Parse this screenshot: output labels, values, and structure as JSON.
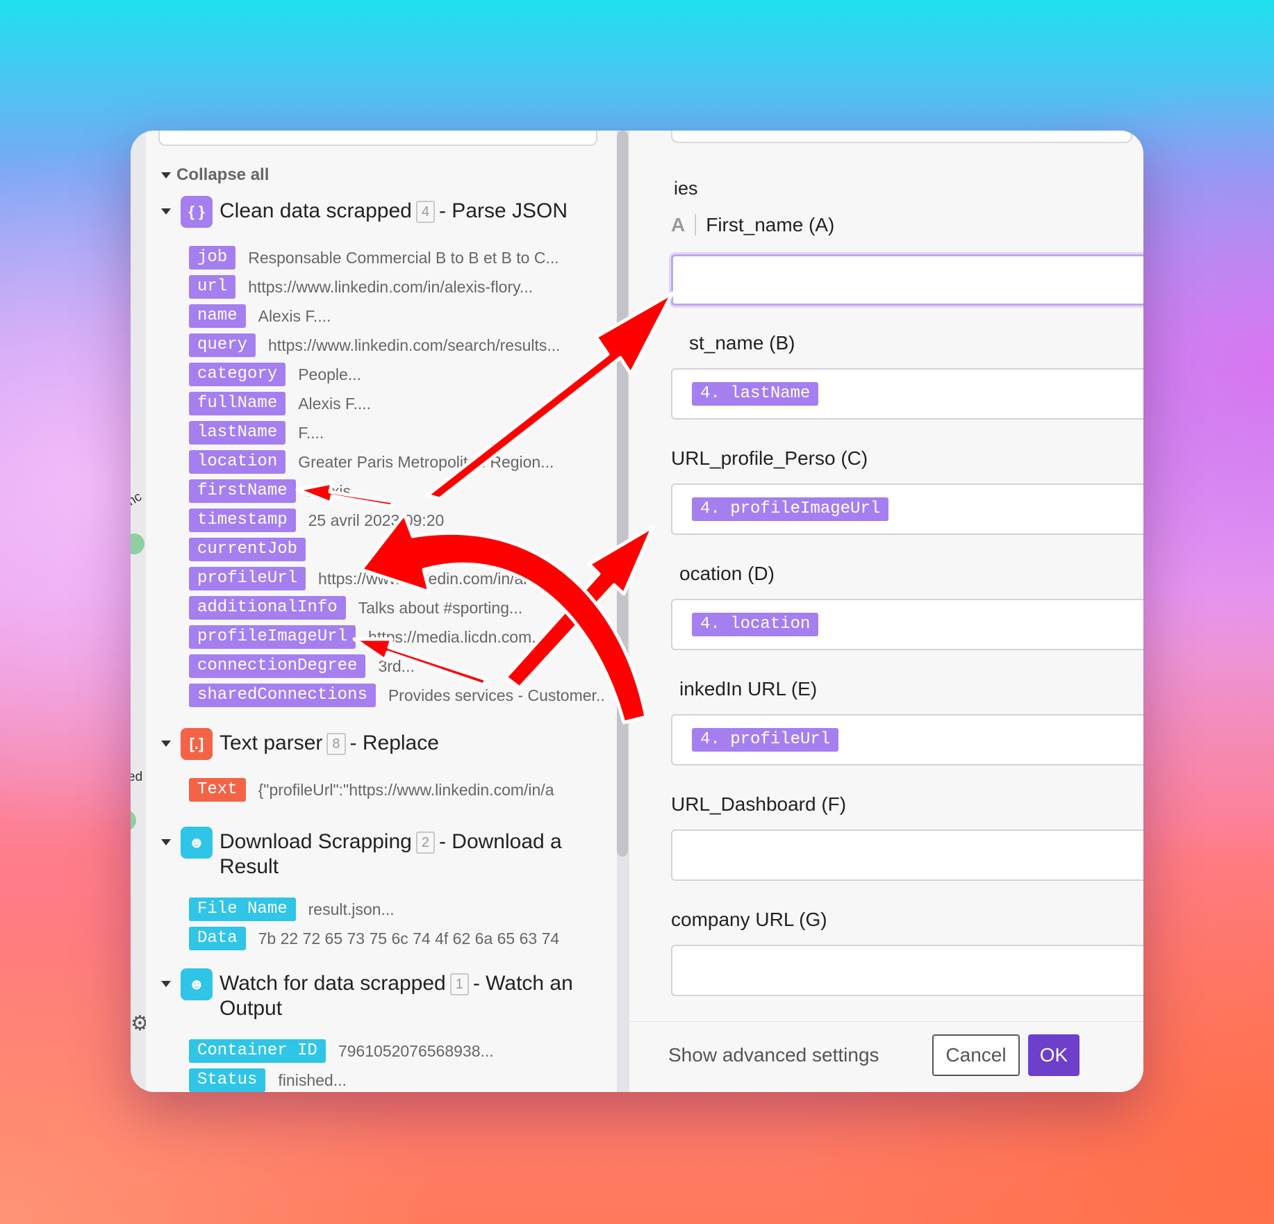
{
  "colors": {
    "purple": "#a57ff0",
    "orange": "#f46346",
    "teal": "#2fc5e6",
    "ok": "#6d3fcb",
    "arrow": "#ff0000"
  },
  "left": {
    "collapse_all": "Collapse all",
    "modules": [
      {
        "icon": "braces-icon",
        "icon_glyph": "{ }",
        "name": "Clean data scrapped",
        "num": "4",
        "action": "- Parse JSON",
        "rows": [
          {
            "key": "job",
            "value": "Responsable Commercial B to B et B to C..."
          },
          {
            "key": "url",
            "value": "https://www.linkedin.com/in/alexis-flory..."
          },
          {
            "key": "name",
            "value": "Alexis F...."
          },
          {
            "key": "query",
            "value": "https://www.linkedin.com/search/results..."
          },
          {
            "key": "category",
            "value": "People..."
          },
          {
            "key": "fullName",
            "value": "Alexis F...."
          },
          {
            "key": "lastName",
            "value": "F...."
          },
          {
            "key": "location",
            "value": "Greater Paris Metropolitan Region..."
          },
          {
            "key": "firstName",
            "value": "Alexis..."
          },
          {
            "key": "timestamp",
            "value": "25 avril 2023 09:20"
          },
          {
            "key": "currentJob",
            "value": ""
          },
          {
            "key": "profileUrl",
            "value": "https://www.linkedin.com/in/alexis..."
          },
          {
            "key": "additionalInfo",
            "value": "Talks about #sporting..."
          },
          {
            "key": "profileImageUrl",
            "value": "https://media.licdn.com..."
          },
          {
            "key": "connectionDegree",
            "value": "3rd..."
          },
          {
            "key": "sharedConnections",
            "value": "Provides services - Customer..."
          }
        ]
      },
      {
        "icon": "text-parser-icon",
        "icon_glyph": "[.]",
        "name": "Text parser",
        "num": "8",
        "action": "- Replace",
        "rows": [
          {
            "key": "Text",
            "value": "{\"profileUrl\":\"https://www.linkedin.com/in/a"
          }
        ]
      },
      {
        "icon": "ghost-icon",
        "icon_glyph": "☻",
        "name": "Download Scrapping",
        "num": "2",
        "action": "- Download a Result",
        "rows": [
          {
            "key": "File Name",
            "value": "result.json..."
          },
          {
            "key": "Data",
            "value": "7b 22 72 65 73 75 6c 74 4f 62 6a 65 63 74"
          }
        ]
      },
      {
        "icon": "ghost-icon",
        "icon_glyph": "☻",
        "name": "Watch for data scrapped",
        "num": "1",
        "action": "- Watch an Output",
        "rows": [
          {
            "key": "Container ID",
            "value": "7961052076568938..."
          },
          {
            "key": "Status",
            "value": "finished..."
          }
        ]
      }
    ]
  },
  "strip": {
    "label_top": "nc",
    "label_mid": "ed"
  },
  "right": {
    "section": "ies",
    "fields": [
      {
        "type": "A",
        "label": "First_name (A)",
        "pill": ""
      },
      {
        "type": "",
        "label": "st_name (B)",
        "pill": "4. lastName"
      },
      {
        "type": "",
        "label": "URL_profile_Perso (C)",
        "pill": "4. profileImageUrl"
      },
      {
        "type": "",
        "label": "ocation (D)",
        "pill": "4. location"
      },
      {
        "type": "",
        "label": "inkedIn URL (E)",
        "pill": "4. profileUrl"
      },
      {
        "type": "",
        "label": "URL_Dashboard (F)",
        "pill": ""
      },
      {
        "type": "",
        "label": "company URL (G)",
        "pill": ""
      }
    ],
    "footer": {
      "advanced": "Show advanced settings",
      "cancel": "Cancel",
      "ok": "OK"
    }
  }
}
